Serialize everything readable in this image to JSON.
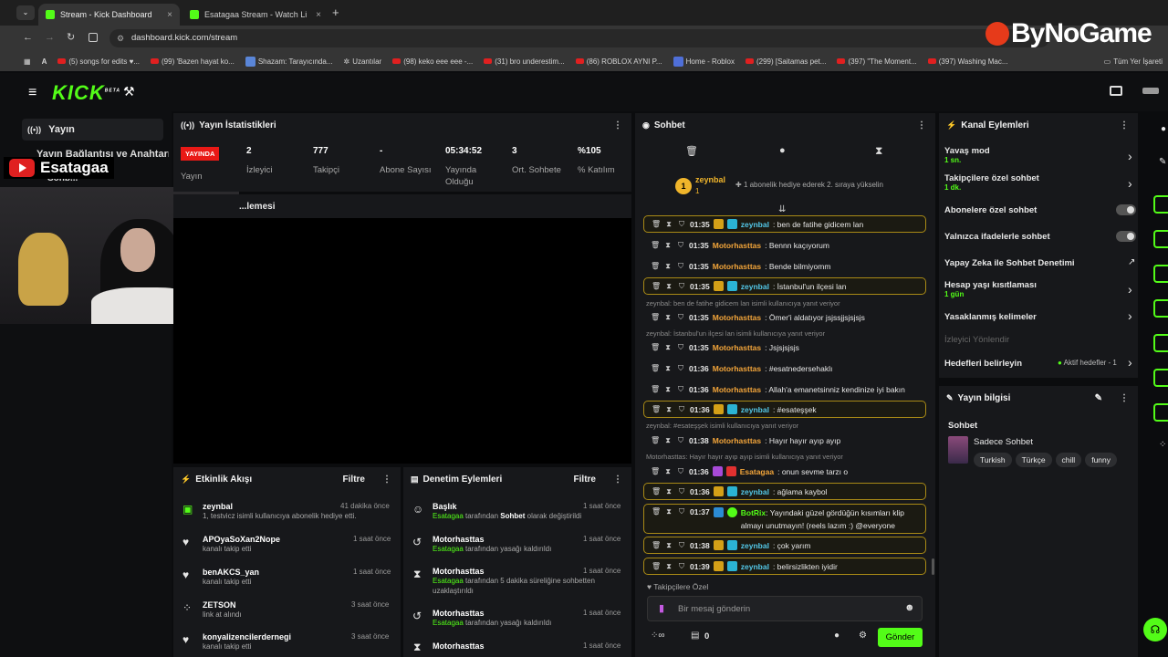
{
  "browser": {
    "tabs": [
      {
        "label": "Stream - Kick Dashboard",
        "close": "×"
      },
      {
        "label": "Esatagaa Stream - Watch Live o",
        "close": "×"
      }
    ],
    "new_tab": "+",
    "url": "dashboard.kick.com/stream",
    "bookmarks": [
      "(5) songs for edits ♥...",
      "(99) 'Bazen hayat ko...",
      "Shazam: Tarayıcında...",
      "Uzantılar",
      "(98) keko eee eee -...",
      "(31) bro underestim...",
      "(86) ROBLOX AYNI P...",
      "Home - Roblox",
      "(299) [Saitamas pet...",
      "(397) \"The Moment...",
      "(397) Washing Mac..."
    ],
    "all_bookmarks": "Tüm Yer İşareti"
  },
  "watermark": "ByNoGame",
  "header": {
    "logo": "KICK",
    "beta": "BETA"
  },
  "sidebar": {
    "active": "Yayın",
    "item2": "Yayın Bağlantısı ve Anahtarı",
    "item3": "Sohb..."
  },
  "stream_overlay": {
    "channel": "Esatagaa"
  },
  "stats": {
    "title": "Yayın İstatistikleri",
    "live_badge": "YAYINDA",
    "live_label": "Yayın",
    "items": [
      {
        "value": "2",
        "label": "İzleyici"
      },
      {
        "value": "777",
        "label": "Takipçi"
      },
      {
        "value": "-",
        "label": "Abone Sayısı"
      },
      {
        "value": "05:34:52",
        "label": "Yayında Olduğu"
      },
      {
        "value": "3",
        "label": "Ort. Sohbete"
      },
      {
        "value": "%105",
        "label": "% Katılım"
      }
    ]
  },
  "preview": {
    "title": "...lemesi"
  },
  "activity": {
    "title": "Etkinlik Akışı",
    "filter": "Filtre",
    "items": [
      {
        "name": "zeynbal",
        "sub": "1, testvicz isimli kullanıcıya abonelik hediye etti.",
        "time": "41 dakika önce"
      },
      {
        "name": "APOyaSoXan2Nope",
        "sub": "kanalı takip etti",
        "time": "1 saat önce"
      },
      {
        "name": "benAKCS_yan",
        "sub": "kanalı takip etti",
        "time": "1 saat önce"
      },
      {
        "name": "ZETSON",
        "sub": "link at alındı",
        "time": "3 saat önce"
      },
      {
        "name": "konyalizencilerdernegi",
        "sub": "kanalı takip etti",
        "time": "3 saat önce"
      }
    ]
  },
  "moderation": {
    "title": "Denetim Eylemleri",
    "filter": "Filtre",
    "items": [
      {
        "name": "Başlık",
        "sub_a": "Esatagaa",
        "sub_b": " tarafından ",
        "sub_c": "Sohbet",
        "sub_d": " olarak değiştirildi",
        "time": "1 saat önce"
      },
      {
        "name": "Motorhasttas",
        "sub_a": "Esatagaa",
        "sub_b": " tarafından yasağı kaldırıldı",
        "sub_c": "",
        "sub_d": "",
        "time": "1 saat önce"
      },
      {
        "name": "Motorhasttas",
        "sub_a": "Esatagaa",
        "sub_b": " tarafından 5 dakika süreliğine sohbetten uzaklaştırıldı",
        "sub_c": "",
        "sub_d": "",
        "time": "1 saat önce"
      },
      {
        "name": "Motorhasttas",
        "sub_a": "Esatagaa",
        "sub_b": " tarafından yasağı kaldırıldı",
        "sub_c": "",
        "sub_d": "",
        "time": "1 saat önce"
      },
      {
        "name": "Motorhasttas",
        "sub_a": "",
        "sub_b": "",
        "sub_c": "",
        "sub_d": "",
        "time": "1 saat önce"
      }
    ]
  },
  "chat": {
    "title": "Sohbet",
    "pinned_user": "zeynbal",
    "pinned_count": "1",
    "pinned_rank": "1",
    "pinned_msg": "1 abonelik hediye ederek 2. sıraya yükselin",
    "messages": [
      {
        "time": "01:35",
        "user": "zeynbal",
        "text": ": ben de fatihe gidicem lan",
        "hl": true,
        "color": "#53c8e8"
      },
      {
        "time": "01:35",
        "user": "Motorhasttas",
        "text": ": Bennn kaçıyorum",
        "hl": false,
        "color": "#f3a53a"
      },
      {
        "time": "01:35",
        "user": "Motorhasttas",
        "text": ": Bende bilmiyomm",
        "hl": false,
        "color": "#f3a53a"
      },
      {
        "time": "01:35",
        "user": "zeynbal",
        "text": ": İstanbul'un ilçesi lan",
        "hl": true,
        "color": "#53c8e8"
      },
      {
        "time": "01:35",
        "user": "Motorhasttas",
        "text": ": Ömer'i aldatıyor jsjssjjsjsjsjs",
        "hl": false,
        "color": "#f3a53a"
      },
      {
        "time": "01:35",
        "user": "Motorhasttas",
        "text": ": Jsjsjsjsjs",
        "hl": false,
        "color": "#f3a53a"
      },
      {
        "time": "01:36",
        "user": "Motorhasttas",
        "text": ": #esatnedersehaklı",
        "hl": false,
        "color": "#f3a53a"
      },
      {
        "time": "01:36",
        "user": "Motorhasttas",
        "text": ": Allah'a emanetsinniz kendinize iyi bakın",
        "hl": false,
        "color": "#f3a53a"
      },
      {
        "time": "01:36",
        "user": "zeynbal",
        "text": ": #esateşşek",
        "hl": true,
        "color": "#53c8e8"
      },
      {
        "time": "01:38",
        "user": "Motorhasttas",
        "text": ": Hayır hayır ayıp ayıp",
        "hl": false,
        "color": "#f3a53a"
      },
      {
        "time": "01:36",
        "user": "Esatagaa",
        "text": ": onun sevme tarzı o",
        "hl": false,
        "color": "#f3a53a"
      },
      {
        "time": "01:36",
        "user": "zeynbal",
        "text": ": ağlama kaybol",
        "hl": true,
        "color": "#53c8e8"
      },
      {
        "time": "01:37",
        "user": "BotRix",
        "text": ": Yayındaki güzel gördüğün kısımları klip",
        "hl": true,
        "color": "#53fc18"
      },
      {
        "time": "01:38",
        "user": "zeynbal",
        "text": ": çok yarım",
        "hl": true,
        "color": "#53c8e8"
      },
      {
        "time": "01:39",
        "user": "zeynbal",
        "text": ": belirsizlikten iyidir",
        "hl": true,
        "color": "#53c8e8"
      }
    ],
    "botrix_line2": "almayı unutmayın! (reels lazım :) @everyone",
    "replies": [
      "zeynbal: ben de fatihe gidicem lan isimli kullanıcıya yanıt veriyor",
      "zeynbal: İstanbul'un ilçesi lan isimli kullanıcıya yanıt veriyor",
      "zeynbal: #esateşşek isimli kullanıcıya yanıt veriyor",
      "Motorhasttas: Hayır hayır ayıp ayıp isimli kullanıcıya yanıt veriyor"
    ],
    "followers_only": "Takipçilere Özel",
    "input_placeholder": "Bir mesaj gönderin",
    "points": "0",
    "send": "Gönder"
  },
  "channel_actions": {
    "title": "Kanal Eylemleri",
    "slow_mode": "Yavaş mod",
    "slow_value": "1 sn.",
    "followers_chat": "Takipçilere özel sohbet",
    "followers_value": "1 dk.",
    "subs_chat": "Abonelere özel sohbet",
    "emote_chat": "Yalnızca ifadelerle sohbet",
    "ai_mod": "Yapay Zeka ile Sohbet Denetimi",
    "account_age": "Hesap yaşı kısıtlaması",
    "account_age_value": "1 gün",
    "banned_words": "Yasaklanmış kelimeler",
    "viewer_redirect": "İzleyici Yönlendir",
    "goals": "Hedefleri belirleyin",
    "goals_value": "Aktif hedefler - 1"
  },
  "stream_info": {
    "title": "Yayın bilgisi",
    "stream_title": "Sohbet",
    "category": "Sadece Sohbet",
    "tags": [
      "Turkish",
      "Türkçe",
      "chill",
      "funny"
    ]
  }
}
